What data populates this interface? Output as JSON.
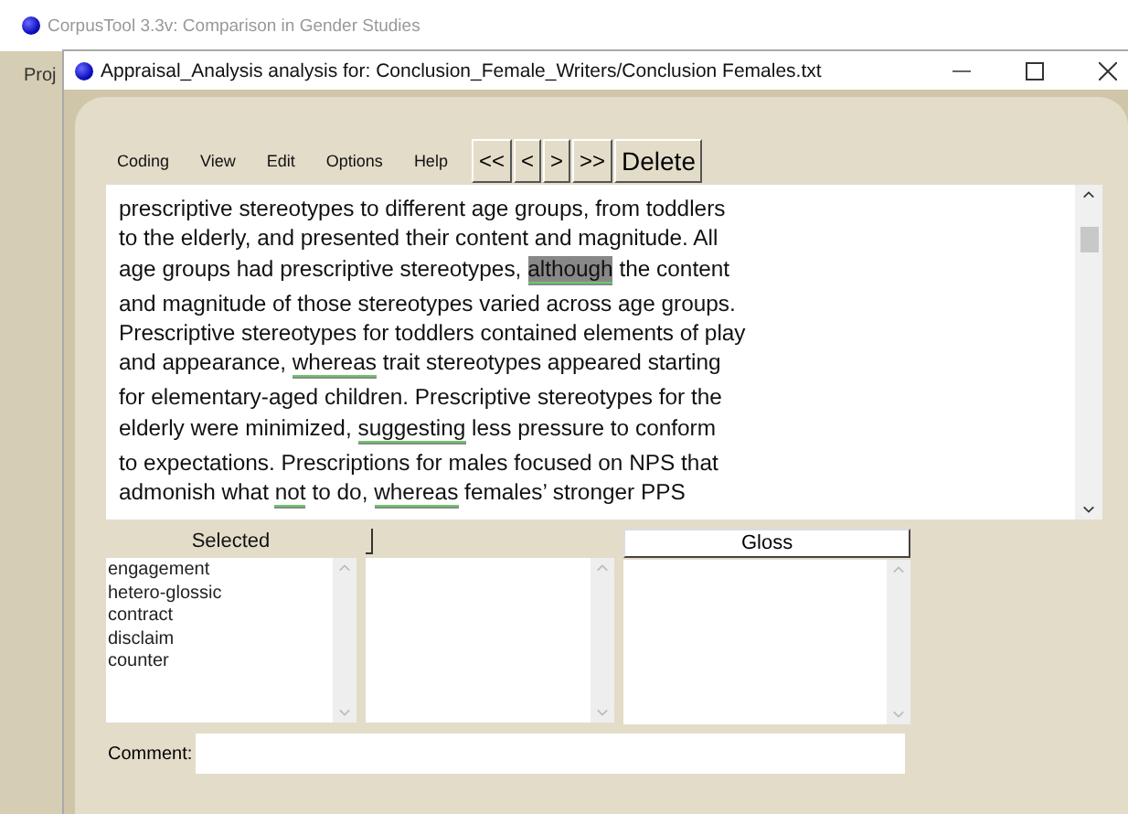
{
  "background_window": {
    "title": "CorpusTool 3.3v: Comparison in Gender Studies",
    "menu": "Proj"
  },
  "window": {
    "title": "Appraisal_Analysis analysis for: Conclusion_Female_Writers/Conclusion Females.txt"
  },
  "menu": [
    "Coding",
    "View",
    "Edit",
    "Options",
    "Help"
  ],
  "nav_buttons": [
    "<<",
    "<",
    ">",
    ">>"
  ],
  "delete_button": "Delete",
  "text_lines": [
    [
      {
        "text": "prescriptive stereotypes to different age groups, from toddlers",
        "coded": false,
        "selected": false
      }
    ],
    [
      {
        "text": "to the elderly, and presented their content and magnitude. All",
        "coded": false,
        "selected": false
      }
    ],
    [
      {
        "text": "age groups had prescriptive stereotypes, ",
        "coded": false,
        "selected": false
      },
      {
        "text": "although",
        "coded": true,
        "selected": true
      },
      {
        "text": " the content",
        "coded": false,
        "selected": false
      }
    ],
    [
      {
        "text": "and magnitude of those stereotypes varied across age groups.",
        "coded": false,
        "selected": false
      }
    ],
    [
      {
        "text": "Prescriptive stereotypes for toddlers contained elements of play",
        "coded": false,
        "selected": false
      }
    ],
    [
      {
        "text": "and appearance, ",
        "coded": false,
        "selected": false
      },
      {
        "text": "whereas",
        "coded": true,
        "selected": false
      },
      {
        "text": " trait stereotypes appeared starting",
        "coded": false,
        "selected": false
      }
    ],
    [
      {
        "text": "for elementary-aged children. Prescriptive stereotypes for the",
        "coded": false,
        "selected": false
      }
    ],
    [
      {
        "text": "elderly were minimized, ",
        "coded": false,
        "selected": false
      },
      {
        "text": "suggesting",
        "coded": true,
        "selected": false
      },
      {
        "text": " less pressure to conform",
        "coded": false,
        "selected": false
      }
    ],
    [
      {
        "text": "to expectations. Prescriptions for males focused on NPS that",
        "coded": false,
        "selected": false
      }
    ],
    [
      {
        "text": "admonish what ",
        "coded": false,
        "selected": false
      },
      {
        "text": "not",
        "coded": true,
        "selected": false
      },
      {
        "text": " to do, ",
        "coded": false,
        "selected": false
      },
      {
        "text": "whereas",
        "coded": true,
        "selected": false
      },
      {
        "text": " females’ stronger PPS",
        "coded": false,
        "selected": false
      }
    ]
  ],
  "columns": [
    {
      "header": "Selected",
      "kind": "label",
      "items": [
        "engagement",
        "hetero-glossic",
        "contract",
        "disclaim",
        "counter"
      ]
    },
    {
      "kind": "blank"
    },
    {
      "header": "Gloss",
      "kind": "button"
    }
  ],
  "comment": {
    "label": "Comment:"
  }
}
